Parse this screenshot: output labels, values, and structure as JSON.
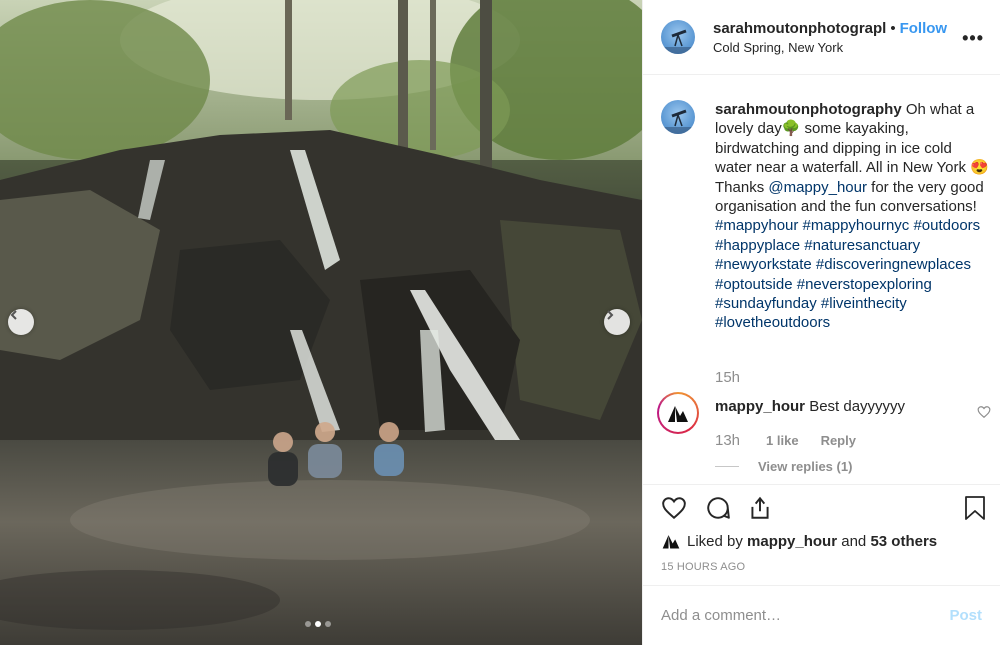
{
  "post": {
    "author": {
      "username": "sarahmoutonphotograpl",
      "follow_label": "Follow",
      "separator": "•",
      "location": "Cold Spring, New York",
      "avatar_icon": "telescope-avatar"
    },
    "more_icon": "more-options-icon",
    "more_label": "•••",
    "carousel": {
      "prev_icon": "chevron-left-icon",
      "next_icon": "chevron-right-icon",
      "slide_count": 3,
      "active_slide": 2
    },
    "caption": {
      "username": "sarahmoutonphotography",
      "text_1": " Oh what a lovely day🌳  some kayaking, birdwatching and dipping in ice cold water near a waterfall. All in New York 😍  Thanks ",
      "mention": "@mappy_hour",
      "text_2": " for the very good organisation and the fun conversations! ",
      "hashtags": "#mappyhour #mappyhournyc #outdoors #happyplace #naturesanctuary #newyorkstate #discoveringnewplaces #optoutside #neverstopexploring #sundayfunday #liveinthecity #lovetheoutdoors",
      "time": "15h"
    },
    "comment": {
      "username": "mappy_hour",
      "text": "Best dayyyyyy",
      "time": "13h",
      "likes": "1 like",
      "reply_label": "Reply",
      "view_replies": "View replies (1)"
    },
    "liked_by": {
      "prefix": "Liked by",
      "user": "mappy_hour",
      "and": "and",
      "others": "53 others"
    },
    "timestamp": "15 HOURS AGO",
    "add_comment": {
      "placeholder": "Add a comment…",
      "post_label": "Post"
    },
    "colors": {
      "link": "#003569",
      "follow": "#3897f0",
      "post_disabled": "#b2dffc",
      "muted": "#8e8e8e"
    }
  }
}
